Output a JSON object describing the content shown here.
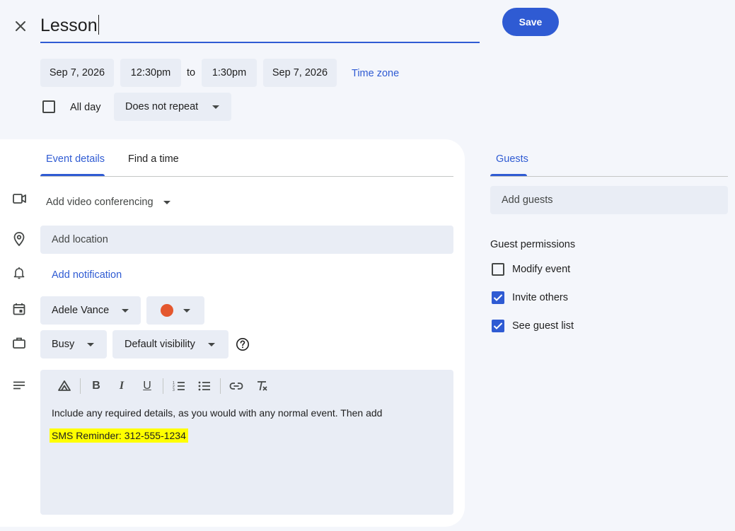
{
  "header": {
    "title_value": "Lesson",
    "save_label": "Save"
  },
  "datetime": {
    "start_date": "Sep 7, 2026",
    "start_time": "12:30pm",
    "to_label": "to",
    "end_time": "1:30pm",
    "end_date": "Sep 7, 2026",
    "timezone_label": "Time zone",
    "allday_label": "All day",
    "allday_checked": false,
    "repeat_value": "Does not repeat"
  },
  "tabs": [
    {
      "label": "Event details",
      "active": true
    },
    {
      "label": "Find a time",
      "active": false
    }
  ],
  "details": {
    "video_label": "Add video conferencing",
    "location_placeholder": "Add location",
    "notification_label": "Add notification",
    "calendar_owner": "Adele Vance",
    "event_color": "#e4572e",
    "availability": "Busy",
    "visibility": "Default visibility",
    "description_line1": "Include any required details, as you would with any normal event.  Then add",
    "description_highlight": "SMS Reminder: 312-555-1234"
  },
  "guests": {
    "tab_label": "Guests",
    "add_placeholder": "Add guests",
    "permissions_title": "Guest permissions",
    "permissions": [
      {
        "label": "Modify event",
        "checked": false
      },
      {
        "label": "Invite others",
        "checked": true
      },
      {
        "label": "See guest list",
        "checked": true
      }
    ]
  },
  "colors": {
    "accent": "#2f5bd3",
    "background": "#f4f6fb",
    "field": "#e9edf5",
    "highlight": "#ffff00"
  }
}
